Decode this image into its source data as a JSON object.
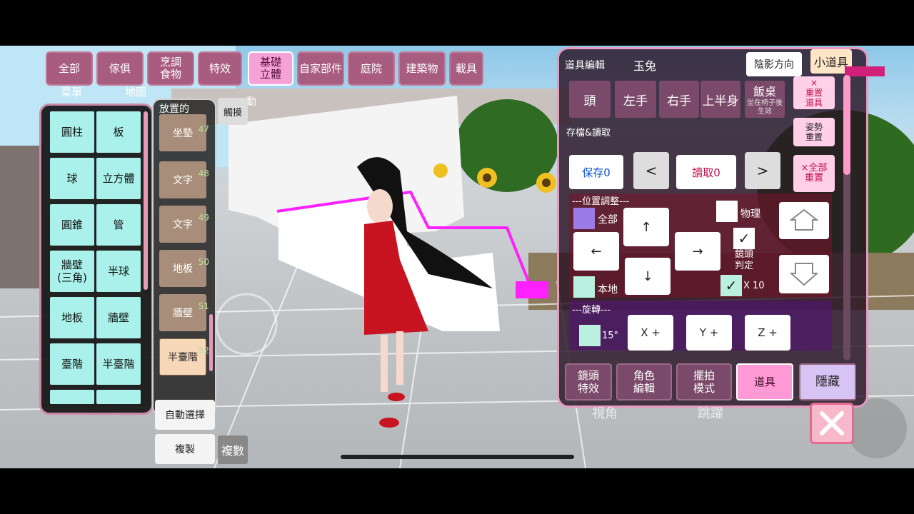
{
  "categories": [
    "全部",
    "傢俱",
    "烹調\n食物",
    "特效",
    "基礎\n立體",
    "自家部件",
    "庭院",
    "建築物",
    "載具"
  ],
  "active_category": "基礎立體",
  "shapes": [
    "圓柱",
    "板",
    "球",
    "立方體",
    "圓錐",
    "管",
    "牆壁\n(三角)",
    "半球",
    "地板",
    "牆壁",
    "臺階",
    "半臺階"
  ],
  "placed": {
    "header": "放置的",
    "items": [
      {
        "label": "坐墊",
        "num": "47"
      },
      {
        "label": "文字",
        "num": "48"
      },
      {
        "label": "文字",
        "num": "49"
      },
      {
        "label": "地板",
        "num": "50"
      },
      {
        "label": "牆壁",
        "num": "51"
      },
      {
        "label": "半臺階",
        "num": "52"
      }
    ]
  },
  "touch_label": "觸摸",
  "auto_select": "自動選擇",
  "copy": "複製",
  "multi": "複數",
  "bg_labels": {
    "menu": "菜單",
    "map": "地圖",
    "action": "動"
  },
  "editor": {
    "title": "道具編輯",
    "char_name": "玉兔",
    "save_ghost": "保存",
    "shadow_dir": "陰影方向",
    "small_item": "小道具",
    "zero": "0",
    "attach": [
      "頭",
      "左手",
      "右手",
      "上半身"
    ],
    "table": "飯桌",
    "table_note": "坐在椅子後\n生效",
    "reset_item": "×\n重置\n道具",
    "reset_pose": "姿勢\n重置",
    "save_load_label": "存檔&讀取",
    "save": "保存0",
    "prev": "<",
    "load": "讀取0",
    "next": ">",
    "reset_all": "×全部\n重置",
    "position_header": "---位置調整---",
    "all": "全部",
    "local": "本地",
    "physics": "物理",
    "camera_judge": "鏡頭\n判定",
    "x10": "X 10",
    "up": "↑",
    "down": "↓",
    "left": "←",
    "right": "→",
    "rotation_header": "---旋轉---",
    "deg": "15°",
    "xplus": "X +",
    "yplus": "Y +",
    "zplus": "Z +",
    "tabs": [
      "鏡頭\n特效",
      "角色\n編輯",
      "擺拍\n模式",
      "道具",
      "隱藏"
    ]
  },
  "ghost_buttons": {
    "view": "視角",
    "jump": "跳躍"
  },
  "colors": {
    "accent": "#f4a2d8",
    "panel_border": "#e59ac0",
    "cell": "#a9f1ea"
  }
}
